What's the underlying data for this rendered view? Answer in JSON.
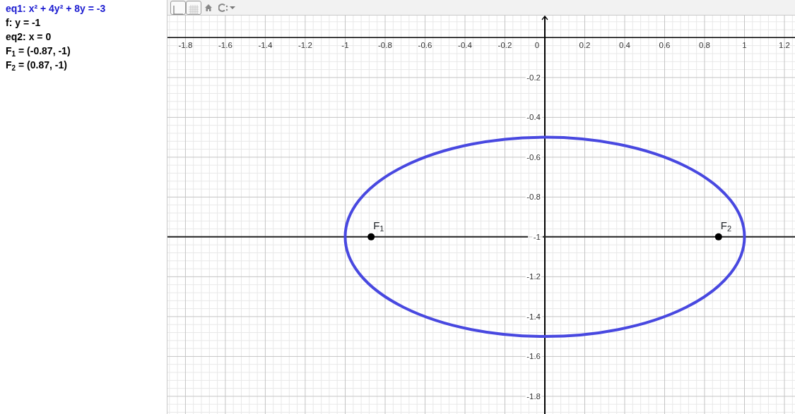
{
  "algebra_view": {
    "items": [
      {
        "text": "eq1: x² + 4y² + 8y = -3",
        "color": "#1a1ad0"
      },
      {
        "text": "f: y = -1",
        "color": "#000000"
      },
      {
        "text": "eq2: x = 0",
        "color": "#000000"
      },
      {
        "text": "F$_{1}$ = (-0.87, -1)",
        "color": "#000000"
      },
      {
        "text": "F$_{2}$ = (0.87, -1)",
        "color": "#000000"
      }
    ]
  },
  "graphics_view": {
    "origin_label": "0",
    "ellipse": {
      "color": "#4848e0"
    },
    "chart_data": {
      "type": "line",
      "grid": true,
      "annotations": [
        {
          "x": -0.87,
          "y": -1,
          "text": "F$_{1}$"
        },
        {
          "x": 0.87,
          "y": -1,
          "text": "F$_{2}$"
        }
      ],
      "xlim": [
        -1.89,
        1.253
      ],
      "ylim": [
        -1.889,
        0.111
      ],
      "xticks": [
        {
          "value": -1.8,
          "label": "-1.8"
        },
        {
          "value": -1.6,
          "label": "-1.6"
        },
        {
          "value": -1.4,
          "label": "-1.4"
        },
        {
          "value": -1.2,
          "label": "-1.2"
        },
        {
          "value": -1,
          "label": "-1"
        },
        {
          "value": -0.8,
          "label": "-0.8"
        },
        {
          "value": -0.6,
          "label": "-0.6"
        },
        {
          "value": -0.4,
          "label": "-0.4"
        },
        {
          "value": -0.2,
          "label": "-0.2"
        },
        {
          "value": 0.2,
          "label": "0.2"
        },
        {
          "value": 0.4,
          "label": "0.4"
        },
        {
          "value": 0.6,
          "label": "0.6"
        },
        {
          "value": 0.8,
          "label": "0.8"
        },
        {
          "value": 1,
          "label": "1"
        },
        {
          "value": 1.2,
          "label": "1.2"
        }
      ],
      "yticks": [
        {
          "value": -0.2,
          "label": "-0.2"
        },
        {
          "value": -0.4,
          "label": "-0.4"
        },
        {
          "value": -0.6,
          "label": "-0.6"
        },
        {
          "value": -0.8,
          "label": "-0.8"
        },
        {
          "value": -1,
          "label": "-1"
        },
        {
          "value": -1.2,
          "label": "-1.2"
        },
        {
          "value": -1.4,
          "label": "-1.4"
        },
        {
          "value": -1.6,
          "label": "-1.6"
        },
        {
          "value": -1.8,
          "label": "-1.8"
        }
      ]
    }
  }
}
